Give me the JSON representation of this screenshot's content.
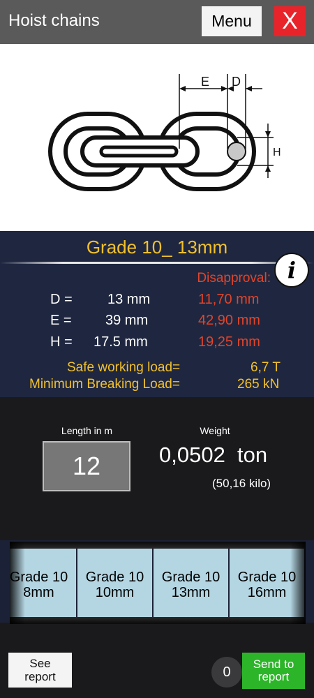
{
  "header": {
    "title": "Hoist chains",
    "menu_label": "Menu",
    "close_label": "X"
  },
  "diagram": {
    "label_e": "E",
    "label_d": "D",
    "label_h": "H"
  },
  "grade": {
    "title": "Grade 10_ 13mm"
  },
  "dimensions": {
    "disapproval_label": "Disapproval:",
    "rows": [
      {
        "name": "D =",
        "value": "13 mm",
        "disapproval": "11,70 mm"
      },
      {
        "name": "E =",
        "value": "39 mm",
        "disapproval": "42,90 mm"
      },
      {
        "name": "H =",
        "value": "17.5 mm",
        "disapproval": "19,25 mm"
      }
    ]
  },
  "loads": {
    "safe_label": "Safe working load=",
    "safe_value": "6,7 T",
    "breaking_label": "Minimum Breaking Load=",
    "breaking_value": "265 kN"
  },
  "length": {
    "label": "Length in m",
    "value": "12"
  },
  "weight": {
    "label": "Weight",
    "value": "0,0502  ton",
    "kilo": "(50,16 kilo)"
  },
  "grades": [
    {
      "line1": "Grade 10",
      "line2": "8mm"
    },
    {
      "line1": "Grade 10",
      "line2": "10mm"
    },
    {
      "line1": "Grade 10",
      "line2": "13mm"
    },
    {
      "line1": "Grade 10",
      "line2": "16mm"
    }
  ],
  "footer": {
    "see_report_line1": "See",
    "see_report_line2": "report",
    "count": "0",
    "send_line1": "Send to",
    "send_line2": "report"
  },
  "colors": {
    "accent_yellow": "#f3c12c",
    "disapproval_red": "#e2442a",
    "close_red": "#e8242a",
    "send_green": "#2db52a",
    "panel_navy": "#1f2740",
    "grade_cell": "#b4d6e3"
  }
}
